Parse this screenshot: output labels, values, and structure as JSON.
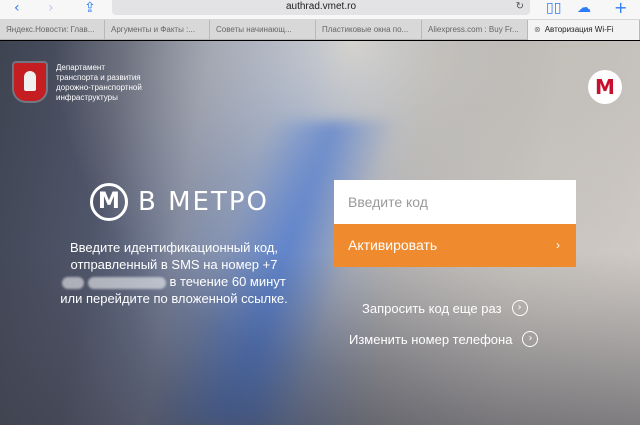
{
  "browser": {
    "url": "authrad.vmet.ro",
    "back_icon": "chevron-left-icon",
    "forward_icon": "chevron-right-icon",
    "share_icon": "share-icon",
    "reload_icon": "reload-icon",
    "tabs_icon": "book-icon",
    "cloud_icon": "cloud-icon",
    "new_tab_icon": "plus-icon",
    "tabs": [
      {
        "label": "Яндекс.Новости: Глав..."
      },
      {
        "label": "Аргументы и Факты :..."
      },
      {
        "label": "Советы начинающ..."
      },
      {
        "label": "Пластиковые окна по..."
      },
      {
        "label": "Aliexpress.com : Buy Fr..."
      },
      {
        "label": "Авторизация Wi-Fi",
        "active": true
      }
    ]
  },
  "header": {
    "department": "Департамент транспорта и развития дорожно-транспортной инфраструктуры"
  },
  "brand": {
    "symbol": "М",
    "text": "В МЕТРО"
  },
  "info": {
    "line1": "Введите идентификационный код, отправленный в SMS на номер +7",
    "line2": "в течение 60 минут",
    "line3": "или перейдите по вложенной ссылке."
  },
  "form": {
    "code_placeholder": "Введите код",
    "activate_label": "Активировать",
    "activate_chevron": "›"
  },
  "links": {
    "resend": "Запросить код еще раз",
    "change_phone": "Изменить номер телефона",
    "arrow": "›"
  },
  "colors": {
    "accent_orange": "#f08a2f",
    "ios_blue": "#2d7cf6",
    "moscow_red": "#c41e22"
  }
}
